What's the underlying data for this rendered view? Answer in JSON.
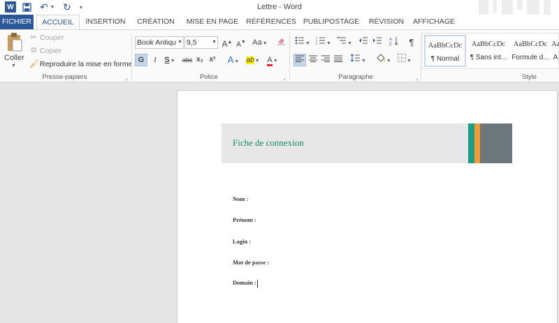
{
  "window": {
    "title": "Lettre - Word"
  },
  "quick_access": {
    "app_icon": "W"
  },
  "tabs": [
    {
      "label": "FICHIER"
    },
    {
      "label": "ACCUEIL"
    },
    {
      "label": "INSERTION"
    },
    {
      "label": "CRÉATION"
    },
    {
      "label": "MISE EN PAGE"
    },
    {
      "label": "RÉFÉRENCES"
    },
    {
      "label": "PUBLIPOSTAGE"
    },
    {
      "label": "RÉVISION"
    },
    {
      "label": "AFFICHAGE"
    }
  ],
  "clipboard": {
    "paste": "Coller",
    "cut": "Couper",
    "copy": "Copier",
    "format_painter": "Reproduire la mise en forme",
    "label": "Presse-papiers"
  },
  "font": {
    "name": "Book Antiqu",
    "size": "9,5",
    "label": "Police",
    "grow": "A",
    "shrink": "A",
    "case": "Aa",
    "bold": "G",
    "italic": "I",
    "underline": "S",
    "strike": "abc",
    "subscript": "x₂",
    "superscript": "x²",
    "effects": "A",
    "highlight": "ab",
    "color": "A"
  },
  "paragraph": {
    "label": "Paragraphe",
    "show_marks": "¶"
  },
  "styles": {
    "label": "Style",
    "items": [
      {
        "sample": "AaBbCcDc",
        "name": "¶ Normal"
      },
      {
        "sample": "AaBbCcDc",
        "name": "¶ Sans int..."
      },
      {
        "sample": "AaBbCcDc",
        "name": "Formule d..."
      },
      {
        "sample": "AaBbCcDc",
        "name": "A"
      }
    ]
  },
  "colors": {
    "brand": "#2b579a",
    "banner_title": "#0f8a6d",
    "stripe_teal": "#1a9e8a",
    "stripe_orange": "#f29a36",
    "stripe_gray": "#6b777c"
  },
  "document": {
    "title": "Fiche de connexion",
    "fields": [
      {
        "label": "Nom :"
      },
      {
        "label": "Prénom :"
      },
      {
        "label": "Login :"
      },
      {
        "label": "Mot de passe :"
      },
      {
        "label": "Domain :"
      }
    ]
  }
}
